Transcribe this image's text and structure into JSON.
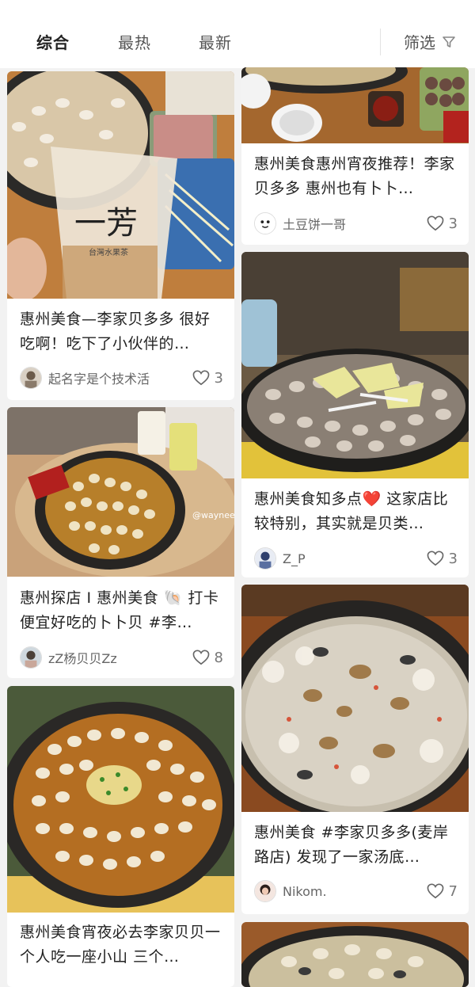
{
  "tabs": {
    "comprehensive": "综合",
    "hottest": "最热",
    "newest": "最新"
  },
  "filter": {
    "label": "筛选",
    "icon": "funnel-icon"
  },
  "left_column": [
    {
      "title": "惠州美食—李家贝多多 很好吃啊！吃下了小伙伴的…",
      "author": "起名字是个技术活",
      "likes": "3",
      "image_text": "一芳",
      "image_subtext": "台灣水果茶"
    },
    {
      "title": "惠州探店 I 惠州美食 🐚 打卡便宜好吃的卜卜贝 #李…",
      "author": "zZ杨贝贝Zz",
      "likes": "8",
      "image_text": "@wayneeeY"
    },
    {
      "title": "惠州美食宵夜必去李家贝贝一个人吃一座小山 三个…",
      "author": "",
      "likes": ""
    }
  ],
  "right_column": [
    {
      "title": "惠州美食惠州宵夜推荐！李家贝多多 惠州也有卜卜…",
      "author": "土豆饼一哥",
      "likes": "3"
    },
    {
      "title": "惠州美食知多点❤️ 这家店比较特别，其实就是贝类…",
      "author": "Z_P",
      "likes": "3"
    },
    {
      "title": "惠州美食 #李家贝多多(麦岸路店) 发现了一家汤底…",
      "author": "Nikom.",
      "likes": "7"
    },
    {
      "title": "",
      "author": "",
      "likes": ""
    }
  ],
  "colors": {
    "page_bg": "#f2f2f2",
    "card_bg": "#ffffff",
    "text": "#222222",
    "muted": "#777777"
  }
}
